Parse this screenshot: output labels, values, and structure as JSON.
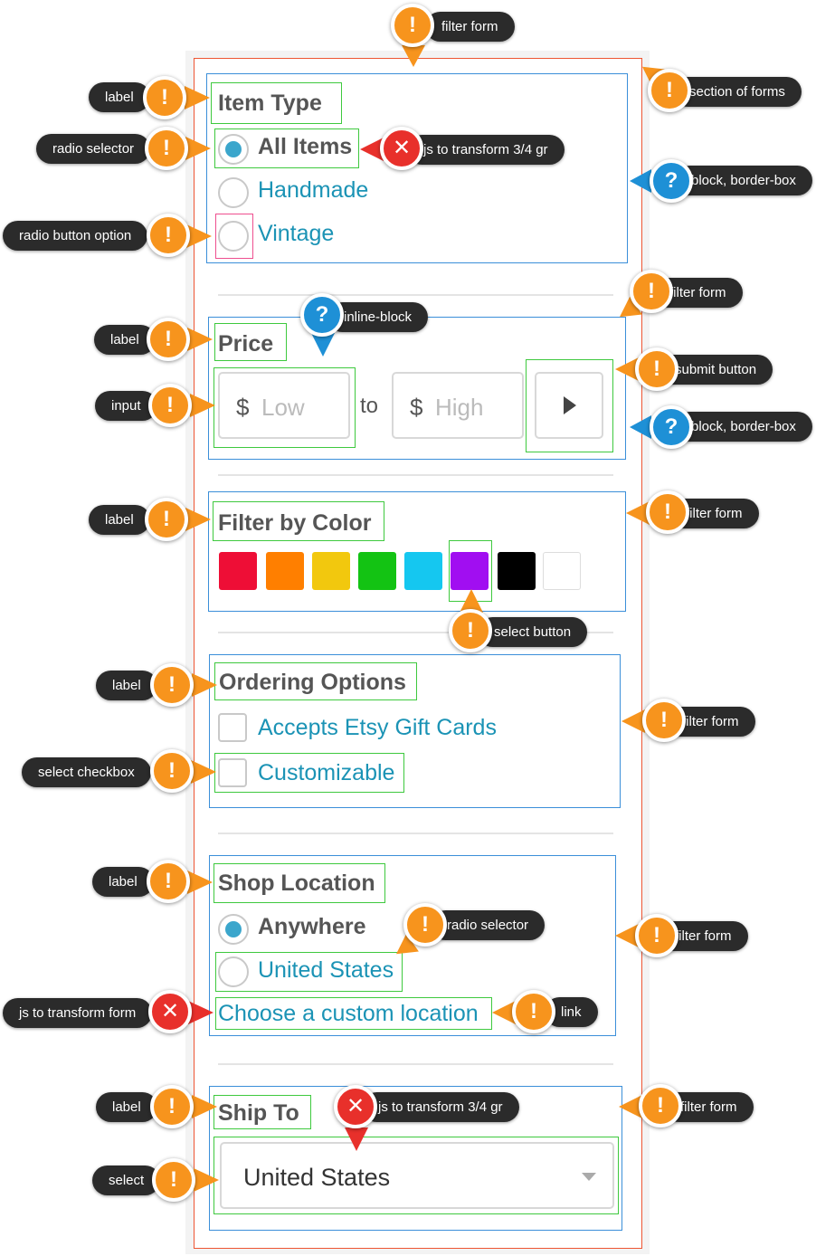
{
  "sections": {
    "item_type": {
      "label": "Item Type",
      "options": [
        "All Items",
        "Handmade",
        "Vintage"
      ],
      "selected": "All Items"
    },
    "price": {
      "label": "Price",
      "currency": "$",
      "low_placeholder": "Low",
      "high_placeholder": "High",
      "to_text": "to"
    },
    "color": {
      "label": "Filter by Color",
      "swatches": [
        "#ee0e36",
        "#ff7f00",
        "#f2c80e",
        "#13c313",
        "#15c7f0",
        "#a10ef1",
        "#000000",
        "#ffffff"
      ],
      "selected": "#a10ef1"
    },
    "ordering": {
      "label": "Ordering Options",
      "options": [
        "Accepts Etsy Gift Cards",
        "Customizable"
      ]
    },
    "shop_location": {
      "label": "Shop Location",
      "options": [
        "Anywhere",
        "United States"
      ],
      "selected": "Anywhere",
      "custom_link": "Choose a custom location"
    },
    "ship_to": {
      "label": "Ship To",
      "value": "United States"
    }
  },
  "annotations": {
    "filter_form_top": "filter form",
    "section_of_forms": "section of forms",
    "block_border_box_1": "block, border-box",
    "label": "label",
    "radio_selector": "radio selector",
    "js_transform_34": "js to transform 3/4 gr",
    "radio_button_option": "radio button option",
    "filter_form": "filter form",
    "inline_block": "inline-block",
    "submit_button": "submit button",
    "input": "input",
    "block_border_box_2": "block, border-box",
    "select_button": "select button",
    "select_checkbox": "select checkbox",
    "js_transform_form": "js to transform form",
    "link": "link",
    "select": "select"
  },
  "colors": {
    "orange_pin": "#f7941d",
    "blue_pin": "#1e90d6",
    "red_pin": "#e8302b",
    "link_teal": "#1b93b5"
  }
}
